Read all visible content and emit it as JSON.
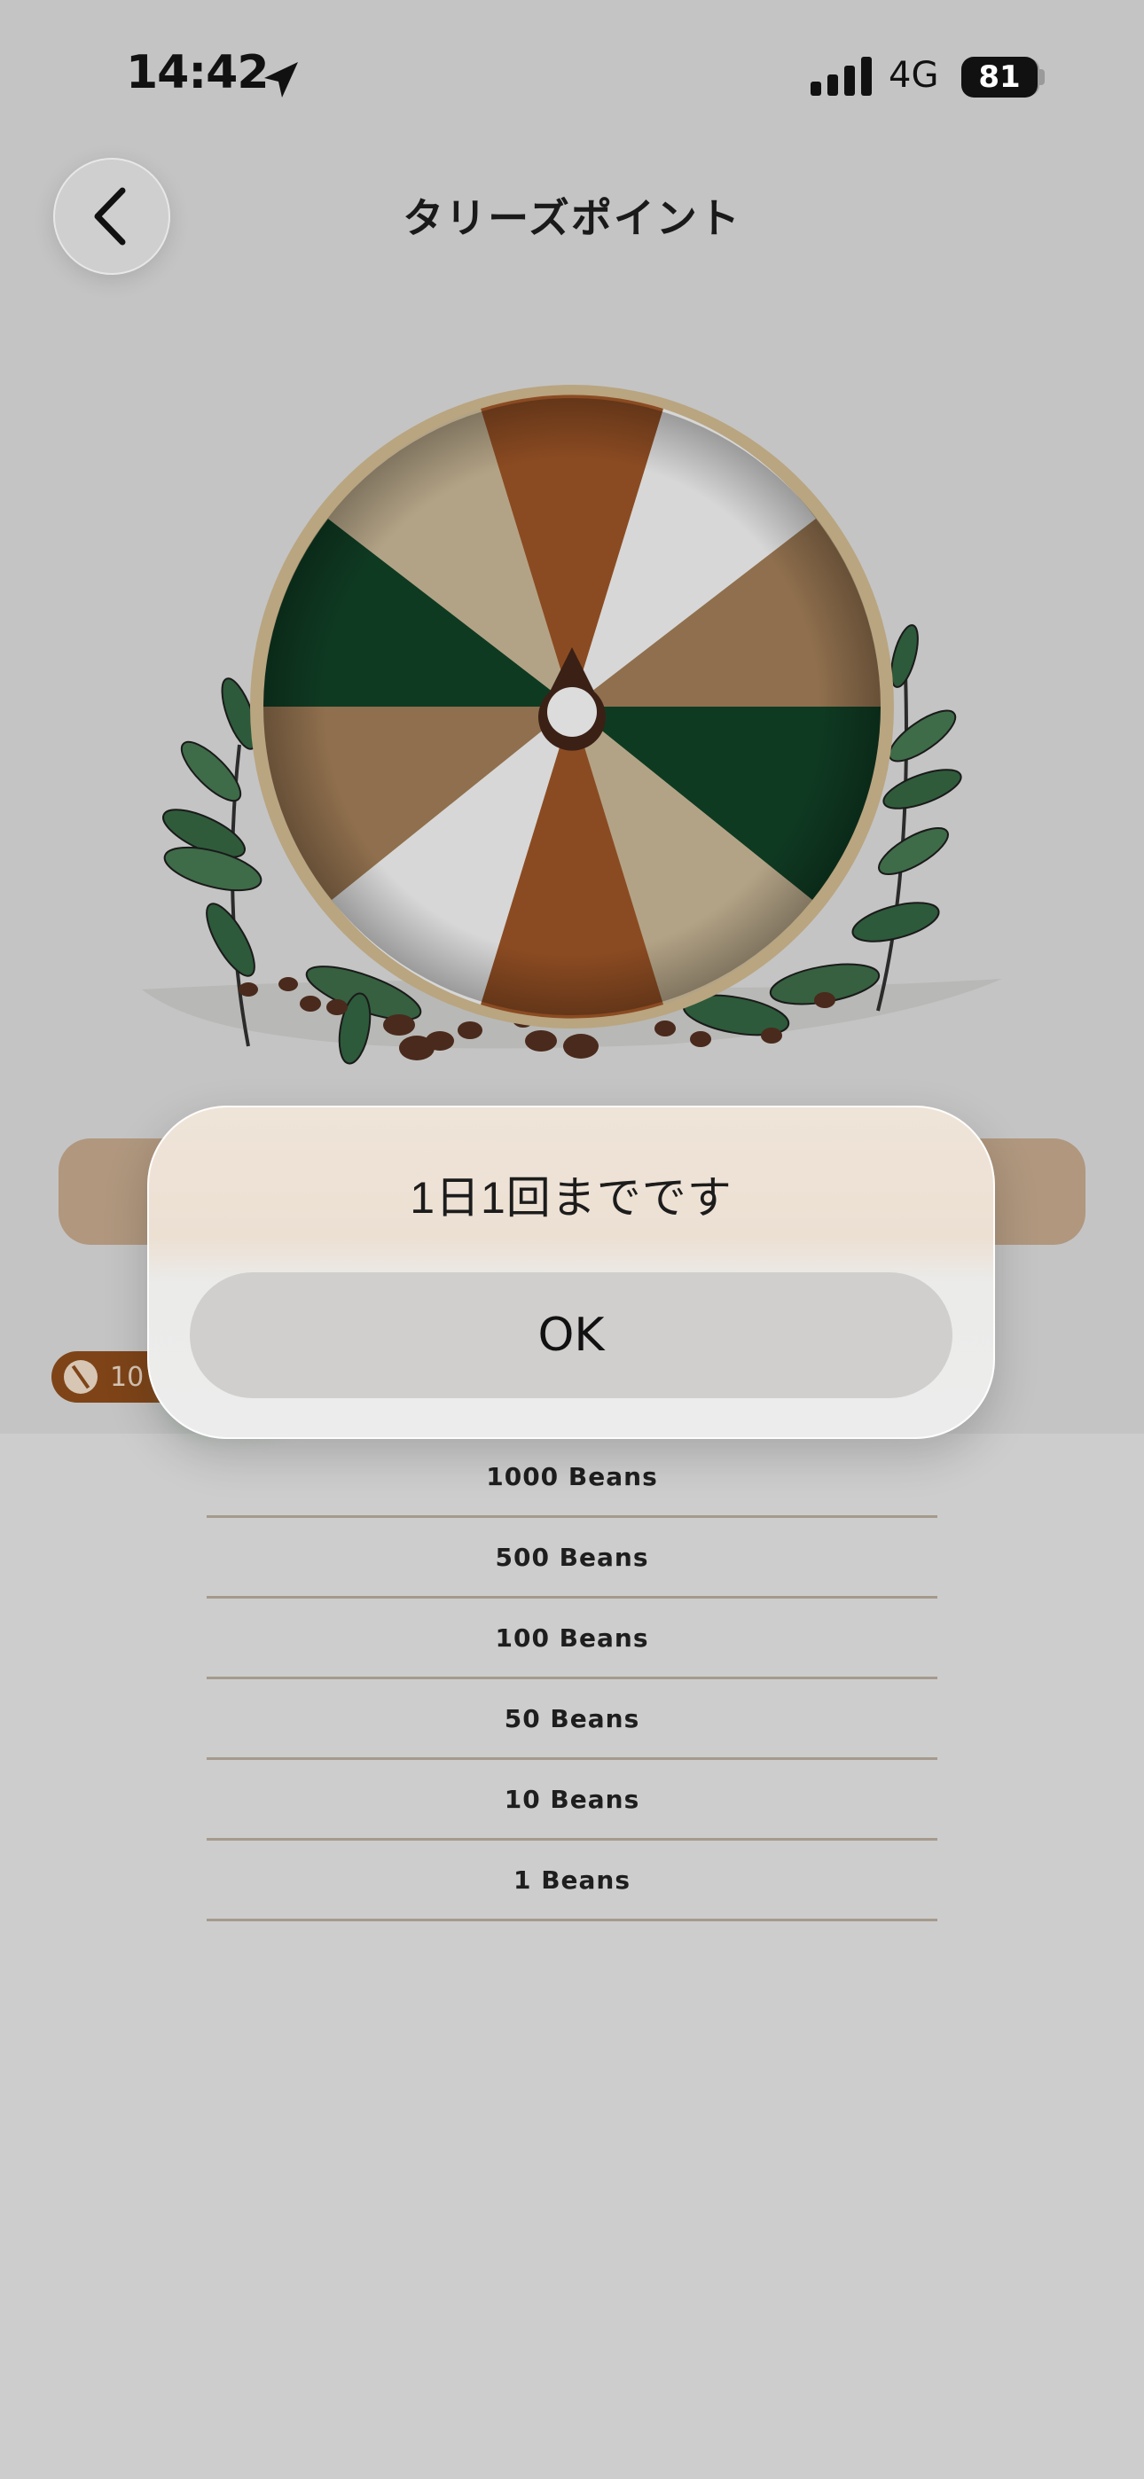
{
  "status_bar": {
    "time": "14:42",
    "network": "4G",
    "battery": "81"
  },
  "header": {
    "title": "タリーズポイント"
  },
  "points_badge": {
    "value_visible": "10"
  },
  "dialog": {
    "message": "1日1回までです",
    "ok_label": "OK"
  },
  "prizes": [
    "1000 Beans",
    "500 Beans",
    "100 Beans",
    "50 Beans",
    "10 Beans",
    "1 Beans"
  ],
  "colors": {
    "dark_green": "#0f3a22",
    "rust_brown": "#8b4b22",
    "tan": "#b3a386",
    "mocha": "#8f6f4d",
    "light_gray": "#d7d7d7",
    "rim": "#b9a580"
  },
  "icons": {
    "back": "chevron-left-icon",
    "location": "location-arrow-icon",
    "signal": "signal-bars-icon",
    "bean": "coffee-bean-icon"
  }
}
